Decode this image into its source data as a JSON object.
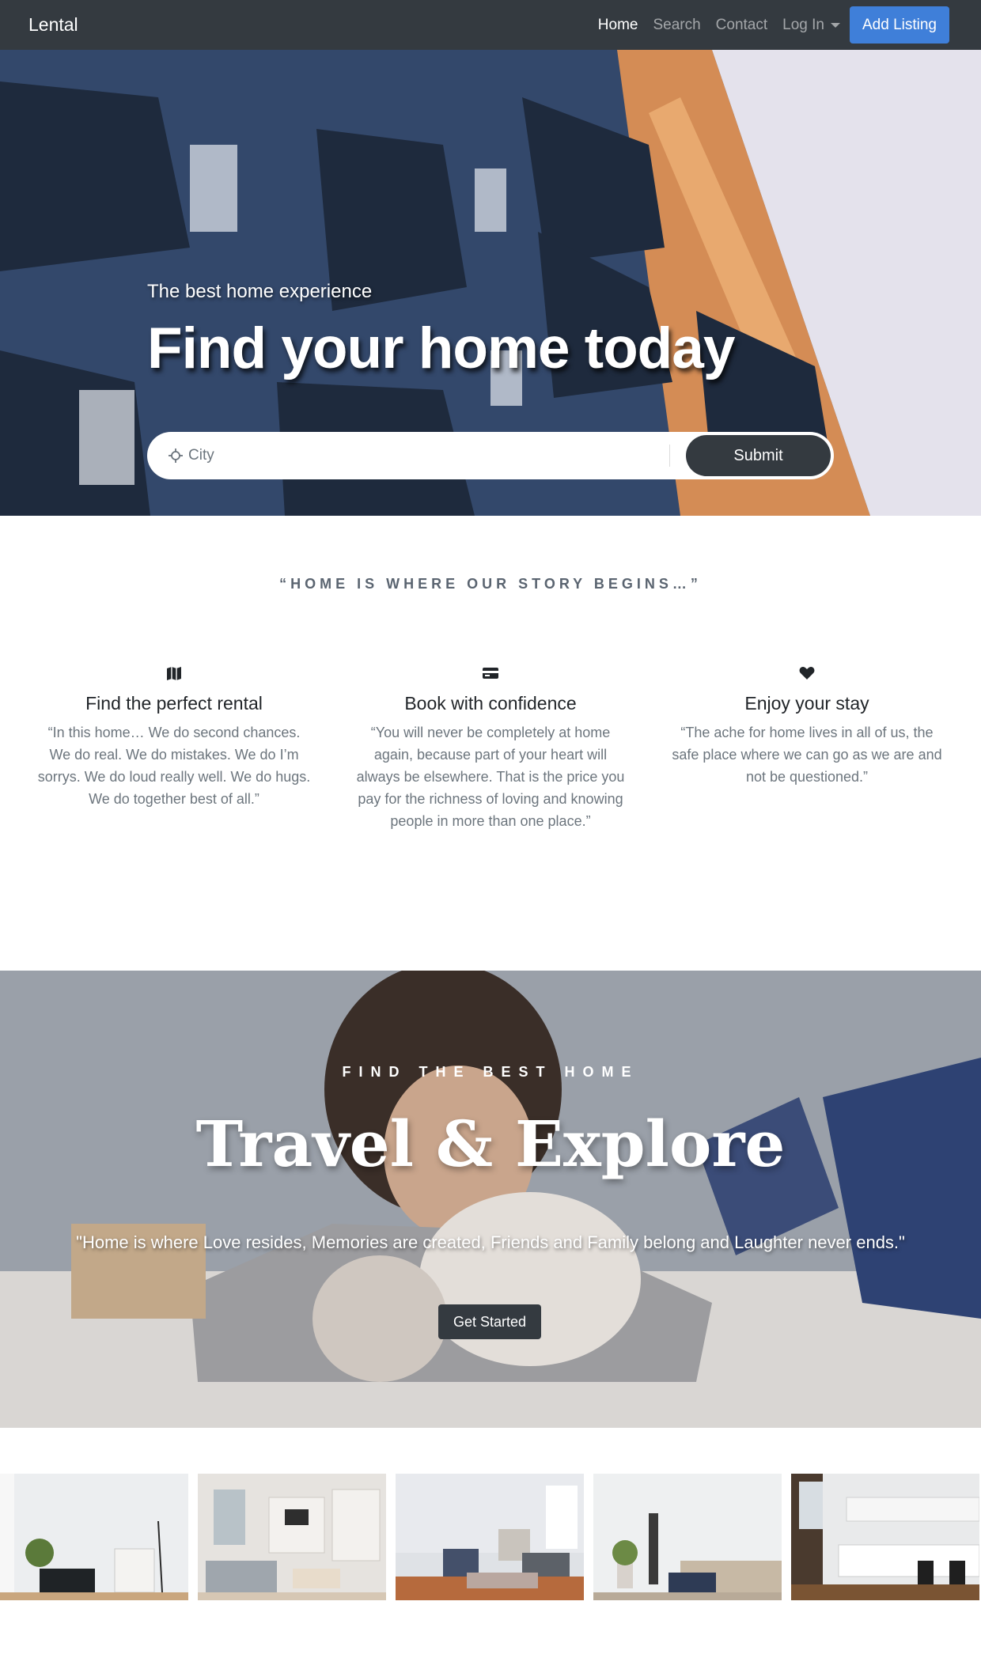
{
  "nav": {
    "brand": "Lental",
    "links": [
      {
        "label": "Home",
        "active": true
      },
      {
        "label": "Search",
        "active": false
      },
      {
        "label": "Contact",
        "active": false
      }
    ],
    "login_label": "Log In",
    "add_listing_label": "Add Listing",
    "colors": {
      "bar": "#343a40",
      "accent": "#3f7fd9"
    }
  },
  "hero": {
    "subtitle": "The best home experience",
    "title": "Find your home today",
    "search": {
      "placeholder": "City",
      "icon": "crosshair-icon"
    },
    "submit_label": "Submit"
  },
  "quote_section": {
    "tagline": "“HOME IS WHERE OUR STORY BEGINS…”",
    "features": [
      {
        "icon": "map-icon",
        "title": "Find the perfect rental",
        "text": "“In this home… We do second chances. We do real. We do mistakes. We do I’m sorrys. We do loud really well. We do hugs. We do together best of all.”"
      },
      {
        "icon": "credit-card-icon",
        "title": "Book with confidence",
        "text": "“You will never be completely at home again, because part of your heart will always be elsewhere. That is the price you pay for the richness of loving and knowing people in more than one place.”"
      },
      {
        "icon": "heart-icon",
        "title": "Enjoy your stay",
        "text": "“The ache for home lives in all of us, the safe place where we can go as we are and not be questioned.”"
      }
    ]
  },
  "travel": {
    "kicker": "FIND THE BEST HOME",
    "title": "Travel & Explore",
    "quote": "\"Home is where Love resides, Memories are created, Friends and Family belong and Laughter never ends.\"",
    "button_label": "Get Started"
  },
  "gallery": {
    "images": [
      "living-room-photo",
      "lounge-shelves-photo",
      "sitting-room-photo",
      "bedroom-photo",
      "kitchen-photo"
    ]
  }
}
